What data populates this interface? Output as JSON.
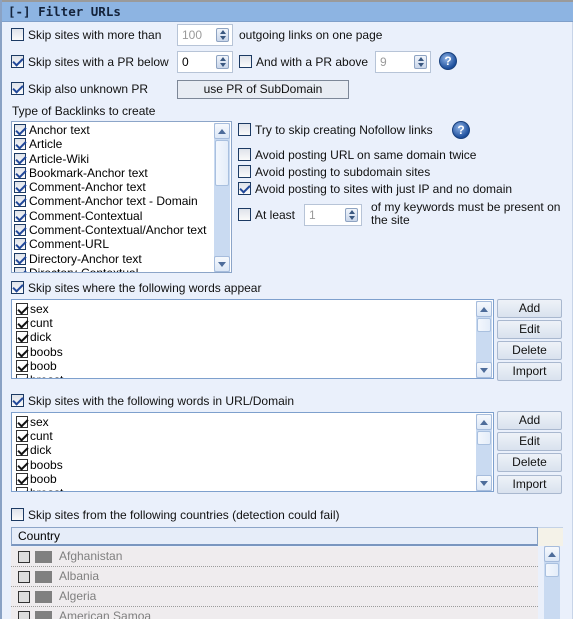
{
  "section": {
    "title": "[-] Filter URLs"
  },
  "options": {
    "skip_more_than": {
      "label": "Skip sites with more than",
      "checked": false,
      "value": "100",
      "suffix": "outgoing links on one page"
    },
    "skip_pr_below": {
      "label": "Skip sites with a PR below",
      "checked": true,
      "value": "0"
    },
    "and_pr_above": {
      "label": "And with a PR above",
      "checked": false,
      "value": "9"
    },
    "skip_unknown_pr": {
      "label": "Skip also unknown PR",
      "checked": true
    },
    "use_pr_subdomain_button": "use PR of SubDomain",
    "help_icon": "?"
  },
  "backlinks": {
    "label": "Type of Backlinks to create",
    "items": [
      {
        "label": "Anchor text",
        "checked": true
      },
      {
        "label": "Article",
        "checked": true
      },
      {
        "label": "Article-Wiki",
        "checked": true
      },
      {
        "label": "Bookmark-Anchor text",
        "checked": true
      },
      {
        "label": "Comment-Anchor text",
        "checked": true
      },
      {
        "label": "Comment-Anchor text - Domain",
        "checked": true
      },
      {
        "label": "Comment-Contextual",
        "checked": true
      },
      {
        "label": "Comment-Contextual/Anchor text",
        "checked": true
      },
      {
        "label": "Comment-URL",
        "checked": true
      },
      {
        "label": "Directory-Anchor text",
        "checked": true
      },
      {
        "label": "Directory-Contextual",
        "checked": true
      }
    ]
  },
  "right_options": {
    "nofollow": {
      "label": "Try to skip creating Nofollow links",
      "checked": false
    },
    "same_domain_twice": {
      "label": "Avoid posting URL on same domain twice",
      "checked": false
    },
    "subdomain_sites": {
      "label": "Avoid posting to subdomain sites",
      "checked": false
    },
    "ip_no_domain": {
      "label": "Avoid posting to sites with just IP and no domain",
      "checked": true
    },
    "at_least": {
      "label": "At least",
      "checked": false,
      "value": "1",
      "suffix_line1": "of my keywords must be present on",
      "suffix_line2": "the site"
    }
  },
  "skip_words": {
    "label": "Skip sites where the following words appear",
    "checked": true,
    "items": [
      "sex",
      "cunt",
      "dick",
      "boobs",
      "boob",
      "breast"
    ],
    "buttons": {
      "add": "Add",
      "edit": "Edit",
      "delete": "Delete",
      "import": "Import"
    }
  },
  "skip_url_words": {
    "label": "Skip sites with the following words in URL/Domain",
    "checked": true,
    "items": [
      "sex",
      "cunt",
      "dick",
      "boobs",
      "boob",
      "breast"
    ],
    "buttons": {
      "add": "Add",
      "edit": "Edit",
      "delete": "Delete",
      "import": "Import"
    }
  },
  "countries": {
    "label": "Skip sites from the following countries (detection could fail)",
    "checked": false,
    "column_header": "Country",
    "rows": [
      "Afghanistan",
      "Albania",
      "Algeria",
      "American Samoa"
    ]
  }
}
